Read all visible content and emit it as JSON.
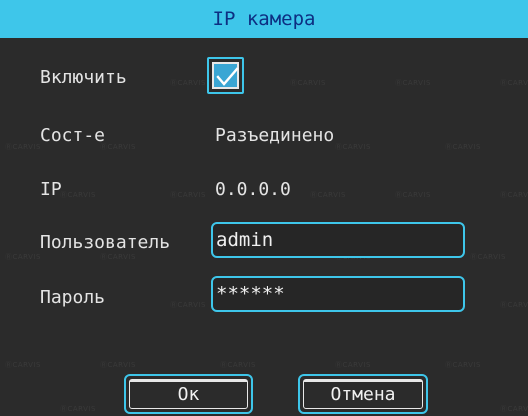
{
  "window": {
    "title": "IP камера"
  },
  "form": {
    "enable_label": "Включить",
    "enable_checked": true,
    "status_label": "Сост-е",
    "status_value": "Разъединено",
    "ip_label": "IP",
    "ip_value": "0.0.0.0",
    "user_label": "Пользователь",
    "user_value": "admin",
    "password_label": "Пароль",
    "password_value": "******"
  },
  "buttons": {
    "ok_label": "Ок",
    "cancel_label": "Отмена"
  },
  "watermark": {
    "text": "ⓇCARVIS"
  },
  "colors": {
    "accent": "#3ec6ea",
    "title_text": "#0d2f82",
    "background": "#2b2b2b"
  }
}
